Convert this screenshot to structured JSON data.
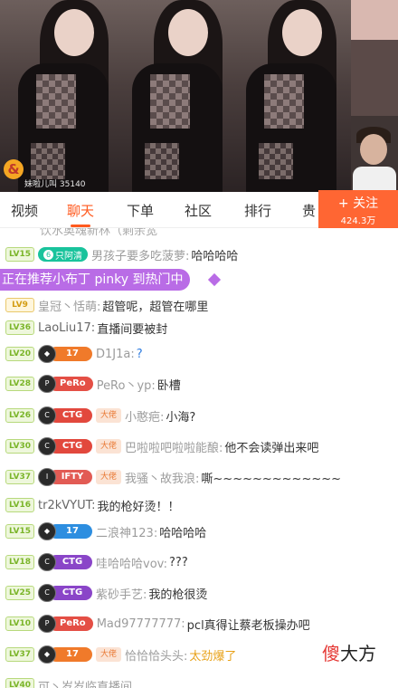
{
  "video": {
    "caption": "妹啦儿叫",
    "viewer_count": "35140"
  },
  "tabs": [
    "视频",
    "聊天",
    "下单",
    "社区",
    "排行",
    "贵"
  ],
  "follow": {
    "label": "+ 关注",
    "count": "424.3万"
  },
  "chat": {
    "cut_top": "饮水奥魂新林（剩余宽",
    "promo": "正在推荐小布丁 pinky 到热门中",
    "rows": [
      {
        "level": "LV15",
        "group": "只阿清",
        "user": "男孩子要多吃菠萝:",
        "msg": "哈哈哈哈"
      },
      {
        "level": "LV9",
        "user": "皇冠丶恬萌:",
        "msg": "超管呢，超管在哪里"
      },
      {
        "level": "LV36",
        "user": "LaoLiu17:",
        "msg": "直播间要被封"
      },
      {
        "level": "LV20",
        "fan": "17",
        "user": "D1J1a:",
        "msg": "?"
      },
      {
        "level": "LV28",
        "fan": "PeRo",
        "user": "PeRo丶yp:",
        "msg": "卧槽"
      },
      {
        "level": "LV26",
        "fan": "CTG",
        "title": "大佬",
        "user": "小憨疤:",
        "msg": "小海?"
      },
      {
        "level": "LV30",
        "fan": "CTG",
        "title": "大佬",
        "user": "巴啦啦吧啦啦能酿:",
        "msg": "他不会读弹出来吧"
      },
      {
        "level": "LV37",
        "fan": "IFTY",
        "title": "大佬",
        "user": "我骚丶故我浪:",
        "msg": "嘶~~~~~~~~~~~~~"
      },
      {
        "level": "LV16",
        "user": "tr2kVYUT:",
        "msg": "我的枪好烫！！"
      },
      {
        "level": "LV15",
        "fan": "17",
        "user": "二浪神123:",
        "msg": "哈哈哈哈"
      },
      {
        "level": "LV18",
        "fan": "CTG",
        "user": "哇哈哈哈vov:",
        "msg": "???"
      },
      {
        "level": "LV25",
        "fan": "CTG",
        "user": "紫砂手艺:",
        "msg": "我的枪很烫"
      },
      {
        "level": "LV10",
        "fan": "PeRo",
        "user": "Mad97777777:",
        "msg": "pcl真得让蔡老板操办吧"
      },
      {
        "level": "LV37",
        "fan": "17",
        "title": "大佬",
        "user": "恰恰恰头头:",
        "msg": "太劲爆了"
      },
      {
        "level": "LV40",
        "user": "可丶岁岁临直播间",
        "msg": ""
      }
    ]
  },
  "watermark": {
    "first": "傻",
    "rest": "大方"
  }
}
